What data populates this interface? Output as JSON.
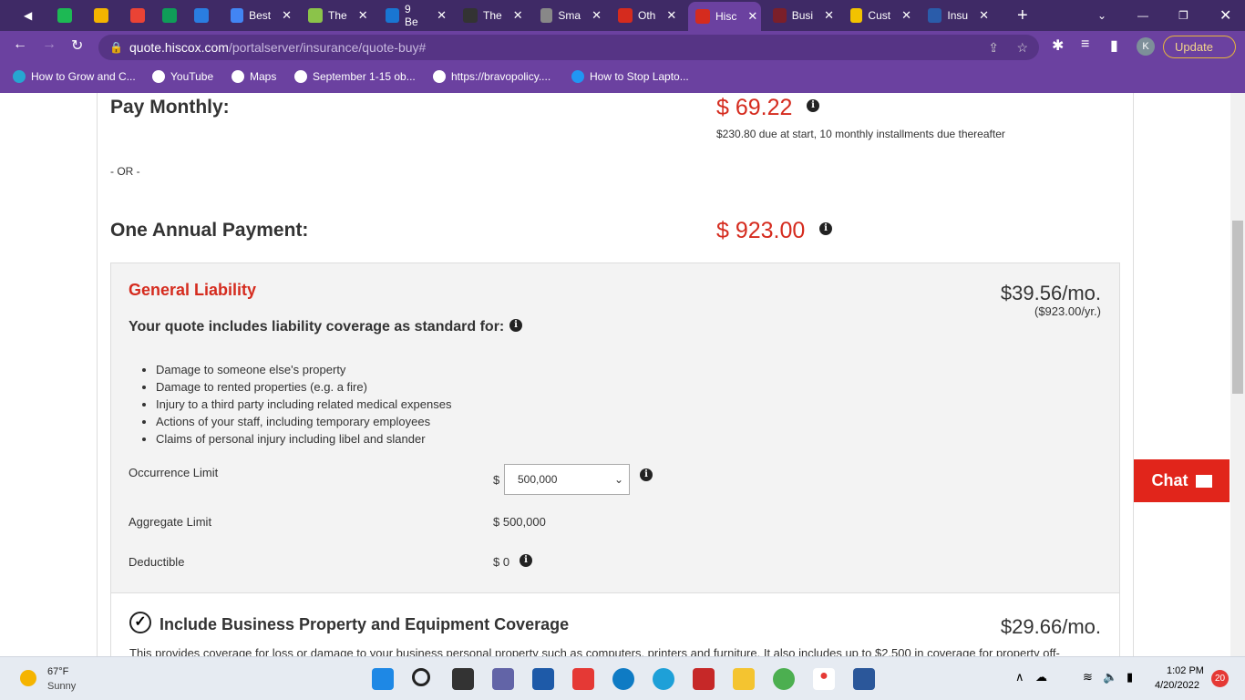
{
  "browser": {
    "tabs": [
      {
        "label": "",
        "color": "#1db954"
      },
      {
        "label": "",
        "color": "#f4b400"
      },
      {
        "label": "",
        "color": "#ea4335"
      },
      {
        "label": "",
        "color": "#0f9d58"
      },
      {
        "label": "",
        "color": "#2a7de1"
      },
      {
        "label": "Best",
        "color": "#4285f4"
      },
      {
        "label": "The",
        "color": "#8bc34a"
      },
      {
        "label": "9 Be",
        "color": "#1976d2"
      },
      {
        "label": "The",
        "color": "#333333"
      },
      {
        "label": "Sma",
        "color": "#888888"
      },
      {
        "label": "Oth",
        "color": "#d52b1e"
      },
      {
        "label": "Hisc",
        "color": "#d52b1e",
        "active": true
      },
      {
        "label": "Busi",
        "color": "#7b1f2a"
      },
      {
        "label": "Cust",
        "color": "#f2c200"
      },
      {
        "label": "Insu",
        "color": "#2a5caa"
      }
    ],
    "url_host": "quote.hiscox.com",
    "url_path": "/portalserver/insurance/quote-buy#",
    "profile_initial": "K",
    "update_label": "Update",
    "bookmarks": [
      "How to Grow and C...",
      "YouTube",
      "Maps",
      "September 1-15 ob...",
      "https://bravopolicy....",
      "How to Stop Lapto..."
    ]
  },
  "quote": {
    "pay_monthly_label": "Pay Monthly:",
    "pay_monthly_price": "$ 69.22",
    "pay_monthly_note": "$230.80 due at start, 10 monthly installments due thereafter",
    "or_label": "- OR -",
    "annual_label": "One Annual Payment:",
    "annual_price": "$ 923.00"
  },
  "general_liability": {
    "title": "General Liability",
    "monthly": "$39.56/mo.",
    "yearly": "($923.00/yr.)",
    "subtitle": "Your quote includes liability coverage as standard for:",
    "items": [
      "Damage to someone else's property",
      "Damage to rented properties (e.g. a fire)",
      "Injury to a third party including related medical expenses",
      "Actions of your staff, including temporary employees",
      "Claims of personal injury including libel and slander"
    ],
    "occurrence_label": "Occurrence Limit",
    "currency": "$",
    "occurrence_value": "500,000",
    "aggregate_label": "Aggregate Limit",
    "aggregate_value": "$ 500,000",
    "deductible_label": "Deductible",
    "deductible_value": "$ 0"
  },
  "property": {
    "title": "Include Business Property and Equipment Coverage",
    "monthly": "$29.66/mo.",
    "description": "This provides coverage for loss or damage to your business personal property such as computers, printers and furniture. It also includes up to $2,500 in coverage for property off-"
  },
  "chat_label": "Chat",
  "taskbar": {
    "temp": "67°F",
    "weather": "Sunny",
    "time": "1:02 PM",
    "date": "4/20/2022",
    "notifications": "20"
  }
}
